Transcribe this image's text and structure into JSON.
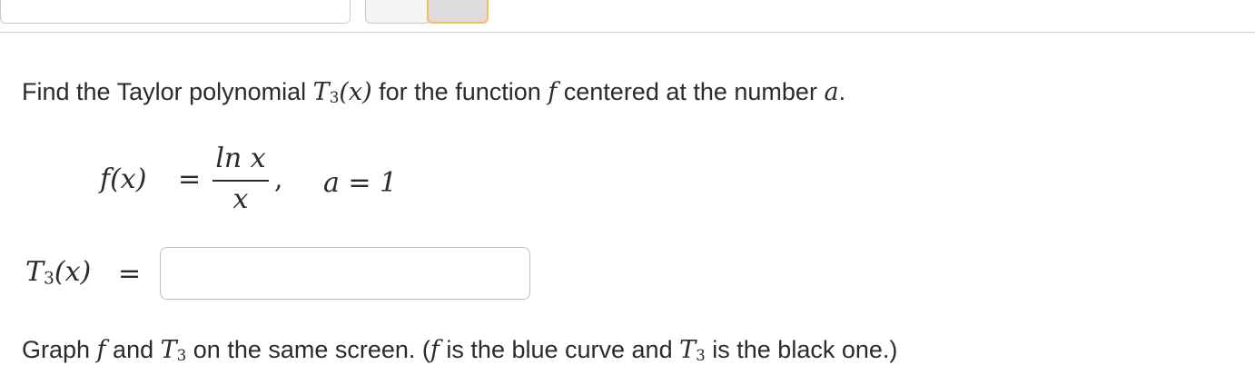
{
  "prompt": {
    "text_before": "Find the Taylor polynomial ",
    "poly_symbol": "T",
    "poly_index": "3",
    "poly_arg": "(x)",
    "text_middle": " for the function ",
    "func_symbol": "f",
    "text_after": " centered at the number ",
    "center_symbol": "a",
    "end_punct": "."
  },
  "function_def": {
    "lhs": "f(x)",
    "equals": "=",
    "numerator": "ln x",
    "denominator": "x",
    "separator": ",",
    "center_label": "a = 1"
  },
  "answer": {
    "lhs_symbol": "T",
    "lhs_index": "3",
    "lhs_arg": "(x)",
    "equals": "=",
    "value": "",
    "placeholder": ""
  },
  "graph_instruction": {
    "text1": "Graph ",
    "f": "f",
    "text2": " and ",
    "t": "T",
    "t_index": "3",
    "text3": " on the same screen. (",
    "f2": "f",
    "text4": " is the blue curve and ",
    "t2": "T",
    "t2_index": "3",
    "text5": " is the black one.)"
  },
  "colors": {
    "divider": "#cfcfcf",
    "input_border": "#bdbdbd",
    "active_button_border": "#f0c060",
    "text": "#2b2b2b"
  }
}
